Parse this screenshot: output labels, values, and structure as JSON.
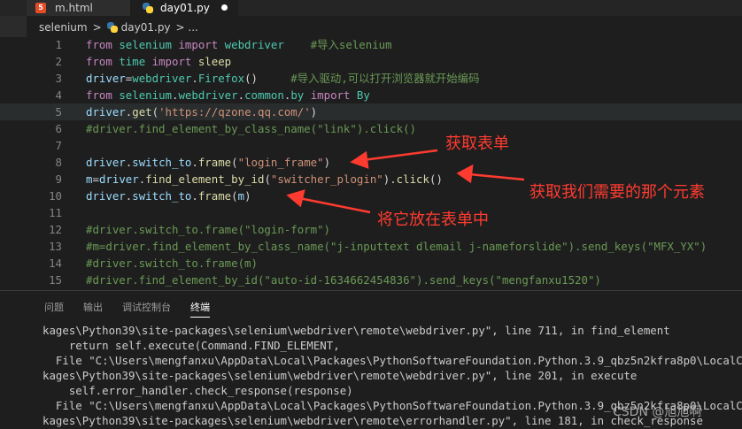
{
  "tabs": [
    {
      "label": "m.html",
      "icon": "html5-icon"
    },
    {
      "label": "day01.py",
      "icon": "python-icon",
      "modified": true
    }
  ],
  "breadcrumb": {
    "folder": "selenium",
    "sep": ">",
    "file": "day01.py",
    "tail": "> ..."
  },
  "code_lines": [
    {
      "n": "1",
      "tokens": [
        [
          "kw",
          "from "
        ],
        [
          "mod",
          "selenium "
        ],
        [
          "kw",
          "import "
        ],
        [
          "mod",
          "webdriver"
        ],
        [
          "pu",
          "    "
        ],
        [
          "cmt",
          "#导入selenium"
        ]
      ]
    },
    {
      "n": "2",
      "tokens": [
        [
          "kw",
          "from "
        ],
        [
          "mod",
          "time "
        ],
        [
          "kw",
          "import "
        ],
        [
          "fn",
          "sleep"
        ]
      ]
    },
    {
      "n": "3",
      "tokens": [
        [
          "var",
          "driver"
        ],
        [
          "pu",
          "="
        ],
        [
          "mod",
          "webdriver"
        ],
        [
          "pu",
          "."
        ],
        [
          "mod",
          "Firefox"
        ],
        [
          "pu",
          "()"
        ],
        [
          "pu",
          "     "
        ],
        [
          "cmt",
          "#导入驱动,可以打开浏览器就开始编码"
        ]
      ]
    },
    {
      "n": "4",
      "tokens": [
        [
          "kw",
          "from "
        ],
        [
          "mod",
          "selenium"
        ],
        [
          "pu",
          "."
        ],
        [
          "mod",
          "webdriver"
        ],
        [
          "pu",
          "."
        ],
        [
          "mod",
          "common"
        ],
        [
          "pu",
          "."
        ],
        [
          "mod",
          "by "
        ],
        [
          "kw",
          "import "
        ],
        [
          "mod",
          "By"
        ]
      ]
    },
    {
      "n": "5",
      "tokens": [
        [
          "var",
          "driver"
        ],
        [
          "pu",
          "."
        ],
        [
          "fn",
          "get"
        ],
        [
          "pu",
          "("
        ],
        [
          "str",
          "'https://qzone.qq.com/'"
        ],
        [
          "pu",
          ")"
        ]
      ]
    },
    {
      "n": "6",
      "tokens": [
        [
          "cmt",
          "#driver.find_element_by_class_name(\"link\").click()"
        ]
      ]
    },
    {
      "n": "7",
      "tokens": []
    },
    {
      "n": "8",
      "tokens": [
        [
          "var",
          "driver"
        ],
        [
          "pu",
          "."
        ],
        [
          "var",
          "switch_to"
        ],
        [
          "pu",
          "."
        ],
        [
          "fn",
          "frame"
        ],
        [
          "pu",
          "("
        ],
        [
          "str",
          "\"login_frame\""
        ],
        [
          "pu",
          ")"
        ]
      ]
    },
    {
      "n": "9",
      "tokens": [
        [
          "var",
          "m"
        ],
        [
          "pu",
          "="
        ],
        [
          "var",
          "driver"
        ],
        [
          "pu",
          "."
        ],
        [
          "fn",
          "find_element_by_id"
        ],
        [
          "pu",
          "("
        ],
        [
          "str",
          "\"switcher_plogin\""
        ],
        [
          "pu",
          ")."
        ],
        [
          "fn",
          "click"
        ],
        [
          "pu",
          "()"
        ]
      ]
    },
    {
      "n": "10",
      "tokens": [
        [
          "var",
          "driver"
        ],
        [
          "pu",
          "."
        ],
        [
          "var",
          "switch_to"
        ],
        [
          "pu",
          "."
        ],
        [
          "fn",
          "frame"
        ],
        [
          "pu",
          "("
        ],
        [
          "var",
          "m"
        ],
        [
          "pu",
          ")"
        ]
      ]
    },
    {
      "n": "11",
      "tokens": []
    },
    {
      "n": "12",
      "tokens": [
        [
          "cmt",
          "#driver.switch_to.frame(\"login-form\")"
        ]
      ]
    },
    {
      "n": "13",
      "tokens": [
        [
          "cmt",
          "#m=driver.find_element_by_class_name(\"j-inputtext dlemail j-nameforslide\").send_keys(\"MFX_YX\")"
        ]
      ]
    },
    {
      "n": "14",
      "tokens": [
        [
          "cmt",
          "#driver.switch_to.frame(m)"
        ]
      ]
    },
    {
      "n": "15",
      "tokens": [
        [
          "cmt",
          "#driver.find_element_by_id(\"auto-id-1634662454836\").send_keys(\"mengfanxu1520\")"
        ]
      ]
    }
  ],
  "annotations": [
    {
      "text": "获取表单"
    },
    {
      "text": "获取我们需要的那个元素"
    },
    {
      "text": "将它放在表单中"
    }
  ],
  "panel": {
    "tabs": [
      "问题",
      "输出",
      "调试控制台",
      "终端"
    ],
    "active": "终端",
    "terminal_lines": [
      "kages\\Python39\\site-packages\\selenium\\webdriver\\remote\\webdriver.py\", line 711, in find_element",
      "    return self.execute(Command.FIND_ELEMENT,",
      "  File \"C:\\Users\\mengfanxu\\AppData\\Local\\Packages\\PythonSoftwareFoundation.Python.3.9_qbz5n2kfra8p0\\LocalCache\\local-pac",
      "kages\\Python39\\site-packages\\selenium\\webdriver\\remote\\webdriver.py\", line 201, in execute",
      "    self.error_handler.check_response(response)",
      "  File \"C:\\Users\\mengfanxu\\AppData\\Local\\Packages\\PythonSoftwareFoundation.Python.3.9_qbz5n2kfra8p0\\LocalCache\\local-pac",
      "kages\\Python39\\site-packages\\selenium\\webdriver\\remote\\errorhandler.py\", line 181, in check_response"
    ]
  },
  "watermark": "CSDN @旭旭啊",
  "colors": {
    "annotation": "#ff3b30",
    "keyword": "#c586c0",
    "module": "#4ec9b0",
    "string": "#ce9178",
    "comment": "#6a9955"
  }
}
